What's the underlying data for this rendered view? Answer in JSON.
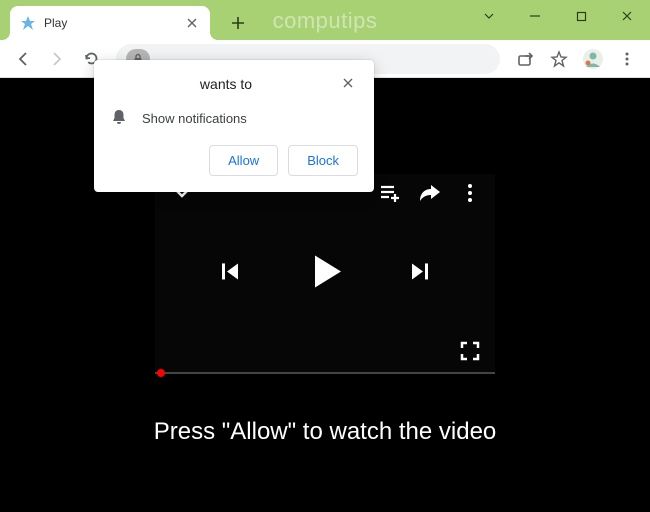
{
  "watermark": "computips",
  "tab": {
    "title": "Play"
  },
  "permission": {
    "title": "wants to",
    "body": "Show notifications",
    "allow": "Allow",
    "block": "Block"
  },
  "page": {
    "instruction": "Press \"Allow\" to watch the video"
  }
}
